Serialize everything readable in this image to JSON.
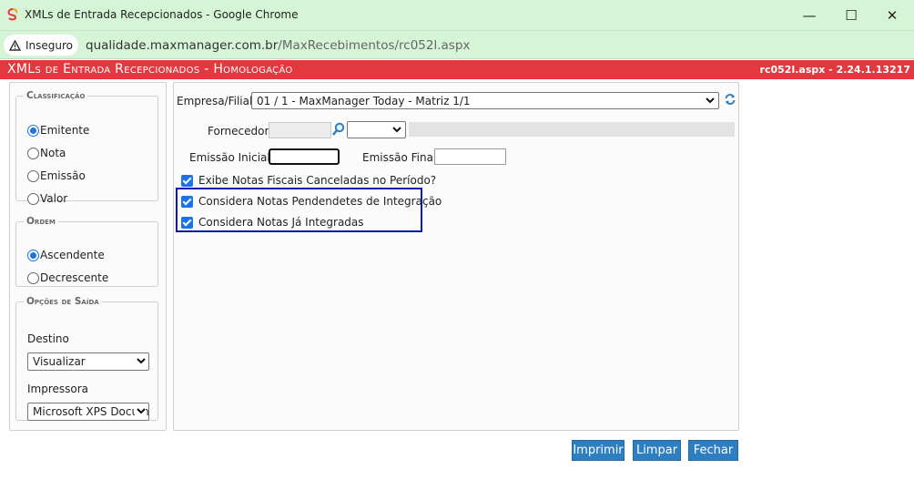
{
  "window": {
    "title": "XMLs de Entrada Recepcionados - Google Chrome",
    "minimize": "—",
    "maximize": "☐",
    "close": "✕"
  },
  "address": {
    "security_label": "Inseguro",
    "url_host": "qualidade.maxmanager.com.br",
    "url_path": "/MaxRecebimentos/rc052l.aspx"
  },
  "app": {
    "title": "XMLs de Entrada Recepcionados",
    "separator": " - ",
    "environment": "Homologação",
    "version": "rc052l.aspx - 2.24.1.13217"
  },
  "sidebar": {
    "classificacao": {
      "legend": "Classificação",
      "options": [
        "Emitente",
        "Nota",
        "Emissão",
        "Valor"
      ],
      "selected": "Emitente"
    },
    "ordem": {
      "legend": "Ordem",
      "options": [
        "Ascendente",
        "Decrescente"
      ],
      "selected": "Ascendente"
    },
    "saida": {
      "legend": "Opções de Saída",
      "destino_label": "Destino",
      "destino_value": "Visualizar",
      "impressora_label": "Impressora",
      "impressora_value": "Microsoft XPS Docum"
    }
  },
  "form": {
    "empresa_label": "Empresa/Filial:",
    "empresa_value": "01 / 1 - MaxManager Today - Matriz 1/1",
    "fornecedor_label": "Fornecedor:",
    "fornecedor_value": "",
    "emissao_inicial_label": "Emissão Inicial:",
    "emissao_inicial_value": "",
    "emissao_final_label": "Emissão Final:",
    "emissao_final_value": "",
    "checkboxes": [
      {
        "label": "Exibe Notas Fiscais Canceladas no Período?",
        "checked": true
      },
      {
        "label": "Considera Notas Pendendetes de Integração",
        "checked": true
      },
      {
        "label": "Considera Notas Já Integradas",
        "checked": true
      }
    ]
  },
  "buttons": {
    "imprimir": "Imprimir",
    "limpar": "Limpar",
    "fechar": "Fechar"
  },
  "colors": {
    "header_red": "#e5373e",
    "chrome_green": "#d6f5d6",
    "button_blue": "#2e7fc1",
    "highlight_navy": "#0a1aa8"
  }
}
